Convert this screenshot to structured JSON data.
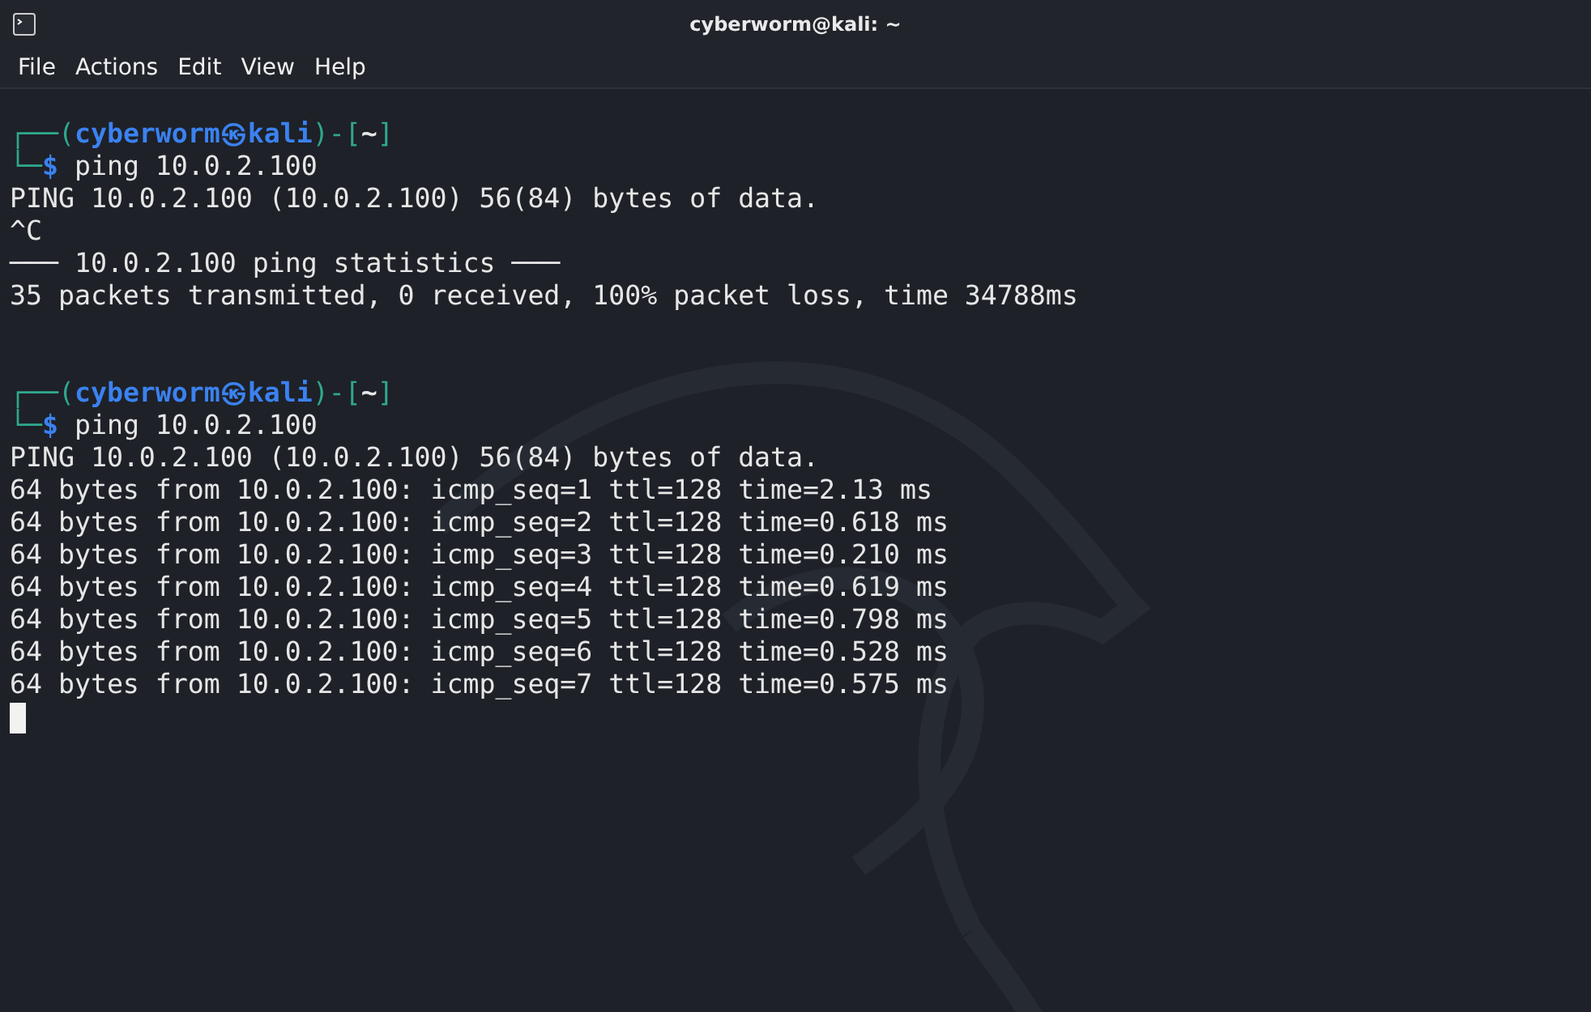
{
  "window": {
    "title": "cyberworm@kali: ~"
  },
  "menu": [
    {
      "label": "File"
    },
    {
      "label": "Actions"
    },
    {
      "label": "Edit"
    },
    {
      "label": "View"
    },
    {
      "label": "Help"
    }
  ],
  "lines": [
    {
      "kind": "prompt",
      "top_left": "┌──(",
      "user": "cyberworm",
      "at": "㉿",
      "host": "kali",
      "sep": ")-[",
      "dir": "~",
      "close": "]",
      "bottom_left": "└─",
      "sign": "$",
      "command": "ping 10.0.2.100"
    },
    {
      "kind": "output",
      "text": "PING 10.0.2.100 (10.0.2.100) 56(84) bytes of data."
    },
    {
      "kind": "output",
      "text": "^C"
    },
    {
      "kind": "output",
      "text": "─── 10.0.2.100 ping statistics ───"
    },
    {
      "kind": "output",
      "text": "35 packets transmitted, 0 received, 100% packet loss, time 34788ms"
    },
    {
      "kind": "blank"
    },
    {
      "kind": "blank"
    },
    {
      "kind": "prompt",
      "top_left": "┌──(",
      "user": "cyberworm",
      "at": "㉿",
      "host": "kali",
      "sep": ")-[",
      "dir": "~",
      "close": "]",
      "bottom_left": "└─",
      "sign": "$",
      "command": "ping 10.0.2.100"
    },
    {
      "kind": "output",
      "text": "PING 10.0.2.100 (10.0.2.100) 56(84) bytes of data."
    },
    {
      "kind": "output",
      "text": "64 bytes from 10.0.2.100: icmp_seq=1 ttl=128 time=2.13 ms"
    },
    {
      "kind": "output",
      "text": "64 bytes from 10.0.2.100: icmp_seq=2 ttl=128 time=0.618 ms"
    },
    {
      "kind": "output",
      "text": "64 bytes from 10.0.2.100: icmp_seq=3 ttl=128 time=0.210 ms"
    },
    {
      "kind": "output",
      "text": "64 bytes from 10.0.2.100: icmp_seq=4 ttl=128 time=0.619 ms"
    },
    {
      "kind": "output",
      "text": "64 bytes from 10.0.2.100: icmp_seq=5 ttl=128 time=0.798 ms"
    },
    {
      "kind": "output",
      "text": "64 bytes from 10.0.2.100: icmp_seq=6 ttl=128 time=0.528 ms"
    },
    {
      "kind": "output",
      "text": "64 bytes from 10.0.2.100: icmp_seq=7 ttl=128 time=0.575 ms"
    },
    {
      "kind": "cursor"
    }
  ]
}
